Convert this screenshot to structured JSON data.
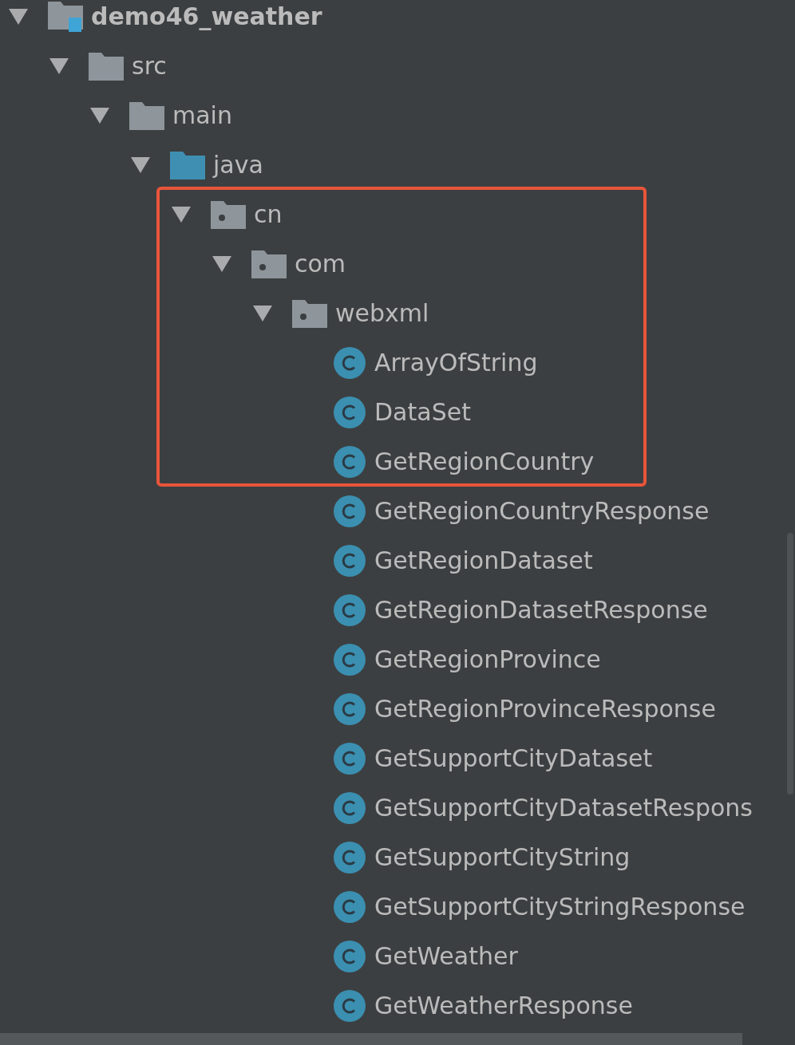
{
  "project_tree": {
    "annotation": {
      "kind": "box"
    },
    "nodes": [
      {
        "label": "demo46_weather",
        "kind": "module",
        "expanded": true,
        "children": [
          {
            "label": "src",
            "kind": "folder",
            "expanded": true,
            "children": [
              {
                "label": "main",
                "kind": "folder",
                "expanded": true,
                "children": [
                  {
                    "label": "java",
                    "kind": "source_folder",
                    "expanded": true,
                    "children": [
                      {
                        "label": "cn",
                        "kind": "package",
                        "expanded": true,
                        "children": [
                          {
                            "label": "com",
                            "kind": "package",
                            "expanded": true,
                            "children": [
                              {
                                "label": "webxml",
                                "kind": "package",
                                "expanded": true,
                                "children": [
                                  {
                                    "label": "ArrayOfString",
                                    "kind": "class"
                                  },
                                  {
                                    "label": "DataSet",
                                    "kind": "class"
                                  },
                                  {
                                    "label": "GetRegionCountry",
                                    "kind": "class"
                                  },
                                  {
                                    "label": "GetRegionCountryResponse",
                                    "kind": "class"
                                  },
                                  {
                                    "label": "GetRegionDataset",
                                    "kind": "class"
                                  },
                                  {
                                    "label": "GetRegionDatasetResponse",
                                    "kind": "class"
                                  },
                                  {
                                    "label": "GetRegionProvince",
                                    "kind": "class"
                                  },
                                  {
                                    "label": "GetRegionProvinceResponse",
                                    "kind": "class"
                                  },
                                  {
                                    "label": "GetSupportCityDataset",
                                    "kind": "class"
                                  },
                                  {
                                    "label": "GetSupportCityDatasetRespons",
                                    "kind": "class"
                                  },
                                  {
                                    "label": "GetSupportCityString",
                                    "kind": "class"
                                  },
                                  {
                                    "label": "GetSupportCityStringResponse",
                                    "kind": "class"
                                  },
                                  {
                                    "label": "GetWeather",
                                    "kind": "class"
                                  },
                                  {
                                    "label": "GetWeatherResponse",
                                    "kind": "class"
                                  }
                                ]
                              }
                            ]
                          }
                        ]
                      }
                    ]
                  }
                ]
              }
            ]
          }
        ]
      }
    ]
  }
}
